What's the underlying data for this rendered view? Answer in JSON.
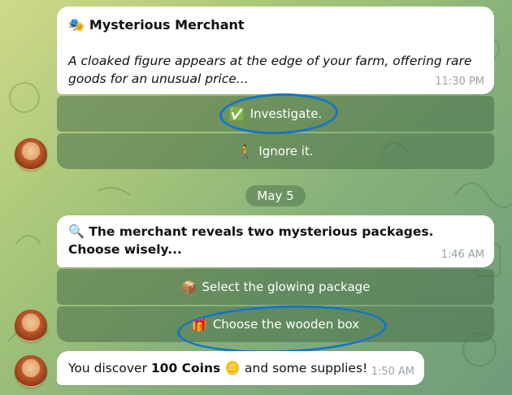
{
  "messages": {
    "m1": {
      "title_icon": "🎭",
      "title": "Mysterious Merchant",
      "body": "A cloaked figure appears at the edge of your farm, offering rare goods for an unusual price...",
      "time": "11:30 PM"
    },
    "m1_buttons": [
      {
        "icon": "✅",
        "label": "Investigate."
      },
      {
        "icon": "🚶",
        "label": "Ignore it."
      }
    ],
    "date_separator": "May 5",
    "m2": {
      "icon": "🔍",
      "text": "The merchant reveals two mysterious packages. Choose wisely...",
      "time": "1:46 AM"
    },
    "m2_buttons": [
      {
        "icon": "📦",
        "label": "Select the glowing package"
      },
      {
        "icon": "🎁",
        "label": "Choose the wooden box"
      }
    ],
    "m3": {
      "prefix": "You discover ",
      "bold": "100 Coins",
      "coin_icon": "🪙",
      "suffix": " and some supplies!",
      "time": "1:50 AM"
    }
  },
  "colors": {
    "annotation": "#1475c9",
    "bubble": "#ffffff",
    "button_bg": "rgba(72,110,72,.55)"
  }
}
